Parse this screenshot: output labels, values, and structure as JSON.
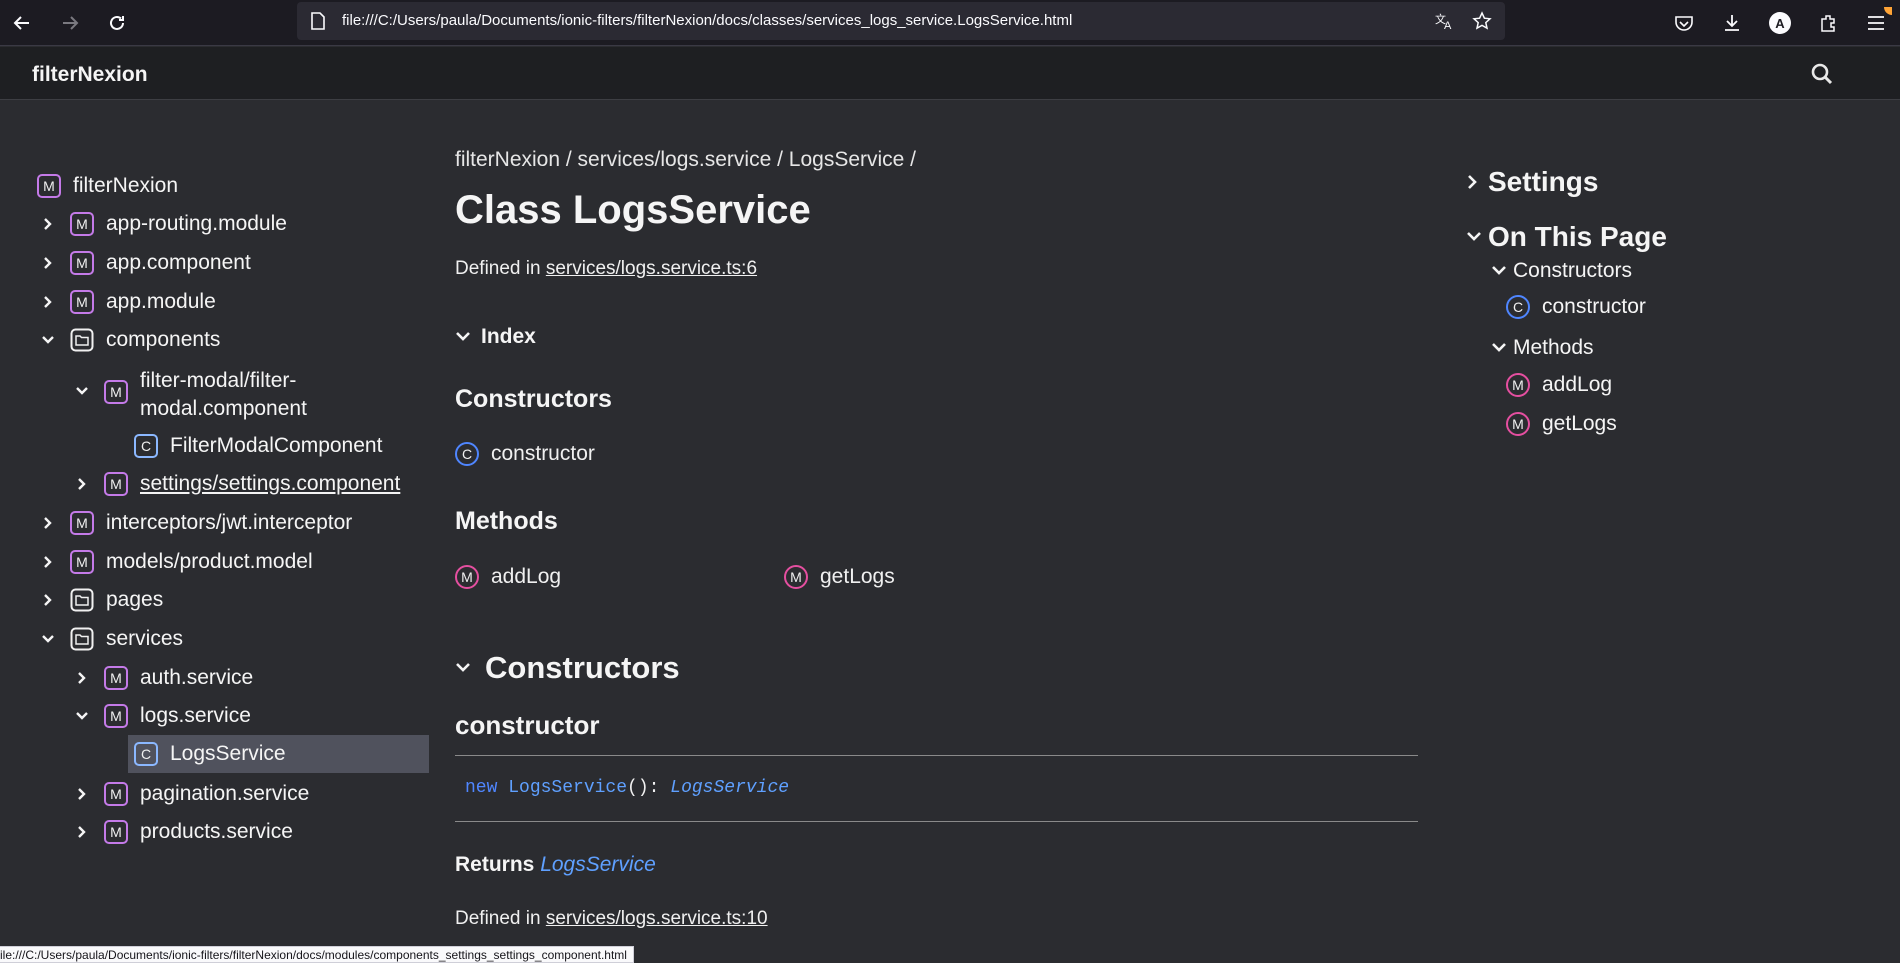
{
  "browser": {
    "url": "file:///C:/Users/paula/Documents/ionic-filters/filterNexion/docs/classes/services_logs_service.LogsService.html",
    "status_url": "ile:///C:/Users/paula/Documents/ionic-filters/filterNexion/docs/modules/components_settings_settings_component.html",
    "profile_initial": "A"
  },
  "header": {
    "title": "filterNexion"
  },
  "sidebar": {
    "root": "filterNexion",
    "items": [
      {
        "label": "app-routing.module",
        "icon": "M"
      },
      {
        "label": "app.component",
        "icon": "M"
      },
      {
        "label": "app.module",
        "icon": "M"
      },
      {
        "label": "components",
        "icon": "folder-icon"
      },
      {
        "label": "filter-modal/filter-",
        "label2": "modal.component",
        "icon": "M"
      },
      {
        "label": "FilterModalComponent",
        "icon": "C"
      },
      {
        "label": "settings/settings.component",
        "icon": "M"
      },
      {
        "label": "interceptors/jwt.interceptor",
        "icon": "M"
      },
      {
        "label": "models/product.model",
        "icon": "M"
      },
      {
        "label": "pages",
        "icon": "folder-icon"
      },
      {
        "label": "services",
        "icon": "folder-icon"
      },
      {
        "label": "auth.service",
        "icon": "M"
      },
      {
        "label": "logs.service",
        "icon": "M"
      },
      {
        "label": "LogsService",
        "icon": "C"
      },
      {
        "label": "pagination.service",
        "icon": "M"
      },
      {
        "label": "products.service",
        "icon": "M"
      }
    ]
  },
  "main": {
    "breadcrumb": "filterNexion / services/logs.service / LogsService /",
    "title": "Class LogsService",
    "defined_prefix": "Defined in ",
    "defined_link": "services/logs.service.ts:6",
    "index_label": "Index",
    "constructors_heading": "Constructors",
    "constructor_link": "constructor",
    "methods_heading": "Methods",
    "methods": [
      "addLog",
      "getLogs"
    ],
    "section_constructors": "Constructors",
    "constructor_heading": "constructor",
    "signature": {
      "kw": "new ",
      "name": "LogsService",
      "paren": "(): ",
      "type": "LogsService"
    },
    "returns_label": "Returns ",
    "returns_type": "LogsService",
    "defined2_prefix": "Defined in ",
    "defined2_link": "services/logs.service.ts:10"
  },
  "right_panel": {
    "settings": "Settings",
    "on_this_page": "On This Page",
    "constructors": "Constructors",
    "constructor": "constructor",
    "methods": "Methods",
    "method_items": [
      "addLog",
      "getLogs"
    ]
  },
  "badges": {
    "module": "M",
    "class": "C"
  },
  "colors": {
    "background": "#2b2c30",
    "header": "#1e1f22",
    "selected": "#50525d",
    "module_badge": "#c47ae8",
    "class_badge": "#8bb8ff",
    "method_badge": "#e54fa0",
    "constructor_badge": "#4f86ff"
  }
}
